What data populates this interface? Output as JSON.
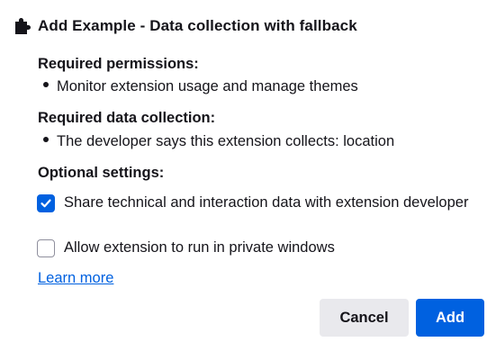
{
  "dialog": {
    "title": "Add Example - Data collection with fallback",
    "header_icon": "puzzle-piece-icon",
    "permissions": {
      "heading": "Required permissions:",
      "items": [
        "Monitor extension usage and manage themes"
      ]
    },
    "data_collection": {
      "heading": "Required data collection:",
      "items": [
        "The developer says this extension collects: location"
      ]
    },
    "optional": {
      "heading": "Optional settings:",
      "options": [
        {
          "label": "Share technical and interaction data with extension developer",
          "checked": true
        },
        {
          "label": "Allow extension to run in private windows",
          "checked": false
        }
      ]
    },
    "learn_more": "Learn more",
    "buttons": {
      "cancel": "Cancel",
      "add": "Add"
    },
    "colors": {
      "accent": "#0061e0",
      "secondary_button": "#e9e9ed",
      "text": "#15141a"
    }
  }
}
